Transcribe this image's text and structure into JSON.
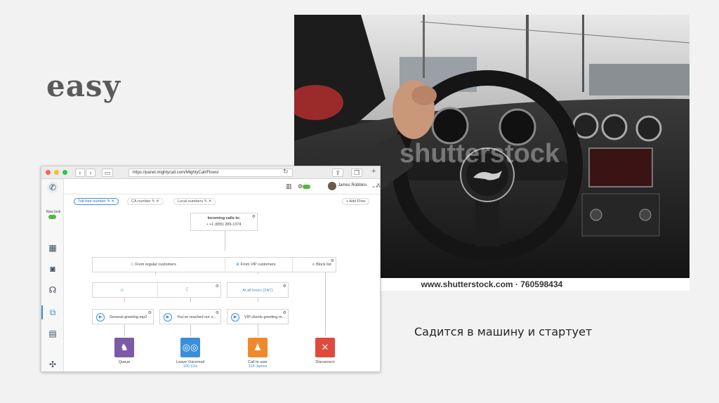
{
  "slide": {
    "title": "easy",
    "subtitle": "Садится в машину и стартует",
    "photo_caption": "www.shutterstock.com · 760598434",
    "watermark": "shutterstock"
  },
  "browser": {
    "url": "https://panel.mightycall.com/MightyCall/Flows/"
  },
  "app": {
    "new_look_label": "New look",
    "user_name": "James Robbins",
    "tabs": [
      {
        "label": "Toll-free number",
        "active": true
      },
      {
        "label": "CA number",
        "active": false
      },
      {
        "label": "Local numbers",
        "active": false
      }
    ],
    "add_flow_label": "+ Add Flow",
    "incoming": {
      "title": "Incoming calls to:",
      "number": "+1 (855) 289-1374"
    },
    "branches": {
      "regular": "From regular customers",
      "vip": "From VIP customers",
      "block": "Block list"
    },
    "hours": {
      "all": "At all hours (24/7)"
    },
    "greetings": {
      "general": "General greeting.mp3",
      "reached": "You've reached our o...",
      "vip": "VIP clients greeting.m..."
    },
    "actions": [
      {
        "label": "Queue",
        "sub": "",
        "color": "#7b5aa6"
      },
      {
        "label": "Leave Voicemail",
        "sub": "100 Cris",
        "color": "#3a8fd8"
      },
      {
        "label": "Call to user",
        "sub": "103 James",
        "color": "#f0892c"
      },
      {
        "label": "Disconnect",
        "sub": "",
        "color": "#e04a3c"
      }
    ]
  },
  "colors": {
    "accent": "#3a8fd8",
    "toggle_on": "#4cbb3c"
  }
}
